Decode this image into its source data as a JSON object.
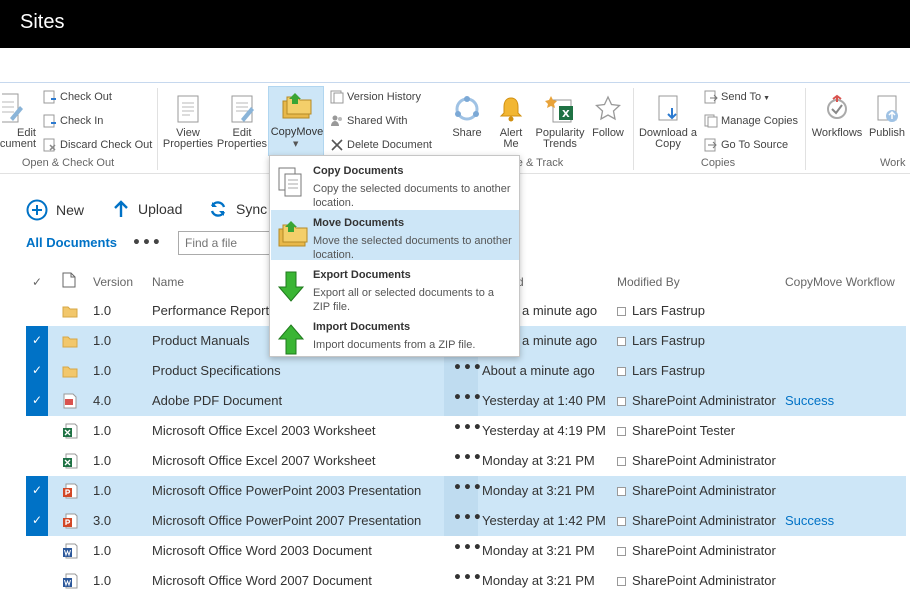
{
  "topbar": {
    "title": "Sites"
  },
  "ribbon": {
    "edit_document": "Edit\nDocument",
    "check_out": "Check Out",
    "check_in": "Check In",
    "discard_check_out": "Discard Check Out",
    "group_open_check_out": "Open & Check Out",
    "view_properties": "View\nProperties",
    "edit_properties": "Edit\nProperties",
    "copymove": "CopyMove",
    "version_history": "Version History",
    "shared_with": "Shared With",
    "delete_document": "Delete Document",
    "share": "Share",
    "alert_me": "Alert\nMe",
    "popularity_trends": "Popularity\nTrends",
    "follow": "Follow",
    "group_share_track": "e & Track",
    "download_copy": "Download a\nCopy",
    "send_to": "Send To",
    "manage_copies": "Manage Copies",
    "go_to_source": "Go To Source",
    "group_copies": "Copies",
    "workflows": "Workflows",
    "publish": "Publish",
    "group_workflows": "Work"
  },
  "commands": {
    "new": "New",
    "upload": "Upload",
    "sync": "Sync"
  },
  "views": {
    "all_documents": "All Documents",
    "more": "•••",
    "search_placeholder": "Find a file"
  },
  "columns": {
    "version": "Version",
    "name": "Name",
    "modified": "d",
    "modified_by": "Modified By",
    "workflow": "CopyMove Workflow"
  },
  "rows": [
    {
      "version": "1.0",
      "name": "Performance Reports",
      "modified": "a minute ago",
      "modified_by": "Lars Fastrup",
      "status": "",
      "selected": false,
      "type": "folder"
    },
    {
      "version": "1.0",
      "name": "Product Manuals",
      "modified": "a minute ago",
      "modified_by": "Lars Fastrup",
      "status": "",
      "selected": true,
      "type": "folder"
    },
    {
      "version": "1.0",
      "name": "Product Specifications",
      "modified": "About a minute ago",
      "modified_by": "Lars Fastrup",
      "status": "",
      "selected": true,
      "type": "folder"
    },
    {
      "version": "4.0",
      "name": "Adobe PDF Document",
      "modified": "Yesterday at 1:40 PM",
      "modified_by": "SharePoint Administrator",
      "status": "Success",
      "selected": true,
      "type": "pdf"
    },
    {
      "version": "1.0",
      "name": "Microsoft Office Excel 2003 Worksheet",
      "modified": "Yesterday at 4:19 PM",
      "modified_by": "SharePoint Tester",
      "status": "",
      "selected": false,
      "type": "excel"
    },
    {
      "version": "1.0",
      "name": "Microsoft Office Excel 2007 Worksheet",
      "modified": "Monday at 3:21 PM",
      "modified_by": "SharePoint Administrator",
      "status": "",
      "selected": false,
      "type": "excel"
    },
    {
      "version": "1.0",
      "name": "Microsoft Office PowerPoint 2003 Presentation",
      "modified": "Monday at 3:21 PM",
      "modified_by": "SharePoint Administrator",
      "status": "",
      "selected": true,
      "type": "ppt"
    },
    {
      "version": "3.0",
      "name": "Microsoft Office PowerPoint 2007 Presentation",
      "modified": "Yesterday at 1:42 PM",
      "modified_by": "SharePoint Administrator",
      "status": "Success",
      "selected": true,
      "type": "ppt"
    },
    {
      "version": "1.0",
      "name": "Microsoft Office Word 2003 Document",
      "modified": "Monday at 3:21 PM",
      "modified_by": "SharePoint Administrator",
      "status": "",
      "selected": false,
      "type": "word"
    },
    {
      "version": "1.0",
      "name": "Microsoft Office Word 2007 Document",
      "modified": "Monday at 3:21 PM",
      "modified_by": "SharePoint Administrator",
      "status": "",
      "selected": false,
      "type": "word"
    }
  ],
  "menu": [
    {
      "title": "Copy Documents",
      "desc": "Copy the selected documents to another location."
    },
    {
      "title": "Move Documents",
      "desc": "Move the selected documents to another location."
    },
    {
      "title": "Export Documents",
      "desc": "Export all or selected documents to a ZIP file."
    },
    {
      "title": "Import Documents",
      "desc": "Import documents from a ZIP file."
    }
  ],
  "colors": {
    "accent": "#0072c6",
    "selection": "#cde6f7"
  }
}
